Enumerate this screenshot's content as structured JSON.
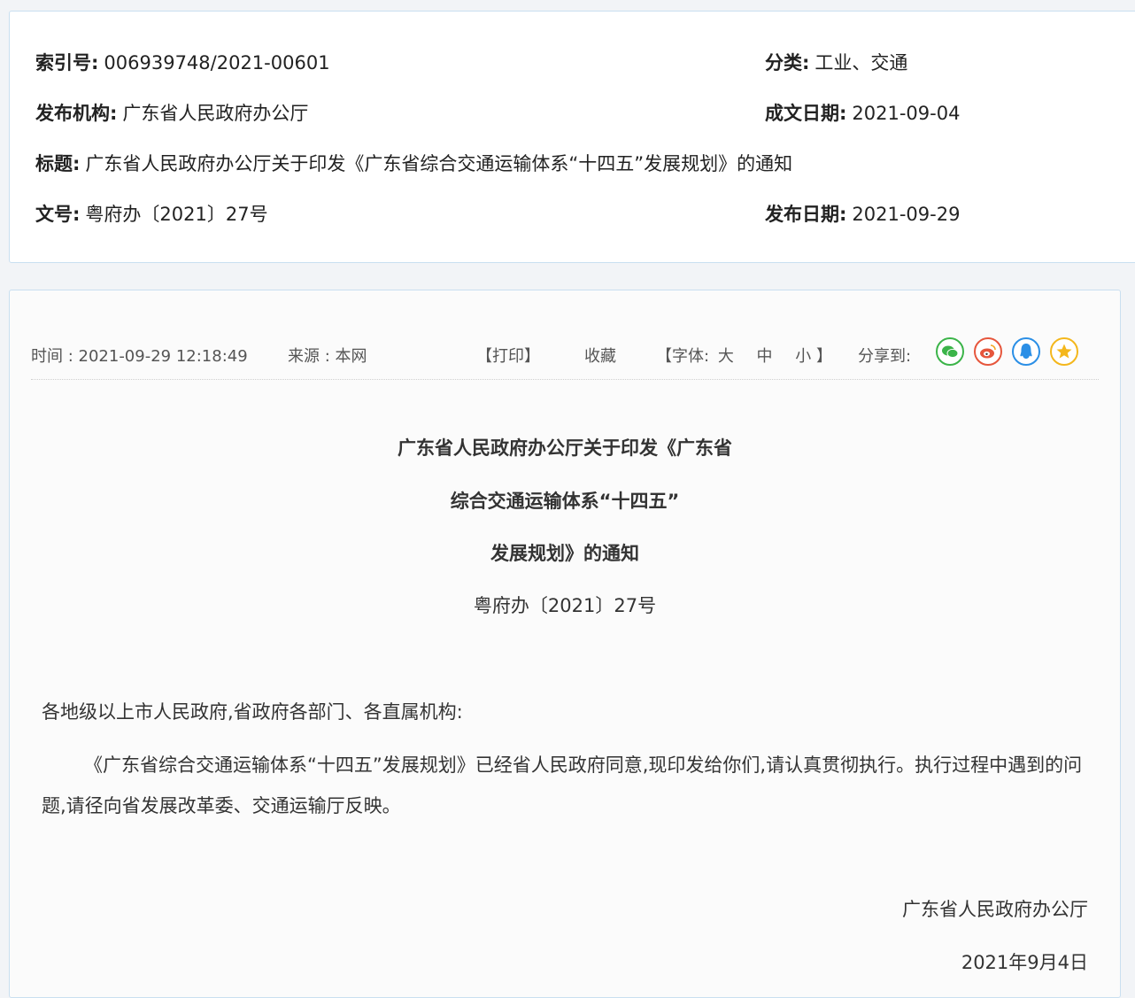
{
  "meta": {
    "index_label": "索引号:",
    "index_value": "006939748/2021-00601",
    "category_label": "分类:",
    "category_value": "工业、交通",
    "org_label": "发布机构:",
    "org_value": "广东省人民政府办公厅",
    "written_date_label": "成文日期:",
    "written_date_value": "2021-09-04",
    "title_label": "标题:",
    "title_value": "广东省人民政府办公厅关于印发《广东省综合交通运输体系“十四五”发展规划》的通知",
    "doc_no_label": "文号:",
    "doc_no_value": "粤府办〔2021〕27号",
    "publish_date_label": "发布日期:",
    "publish_date_value": "2021-09-29"
  },
  "info_bar": {
    "time": "时间 : 2021-09-29 12:18:49",
    "source": "来源 : 本网",
    "print": "【打印】",
    "favorite": "收藏",
    "font_open": "【字体:",
    "font_large": "大",
    "font_medium": "中",
    "font_small": "小",
    "font_close": "】",
    "share_label": "分享到:",
    "share_icons": [
      "wechat-icon",
      "weibo-icon",
      "qq-icon",
      "qzone-icon"
    ],
    "colors": {
      "wechat": "#3bb449",
      "weibo": "#e6563c",
      "qq": "#2b8fe6",
      "qzone": "#f4b71c"
    }
  },
  "article": {
    "title_line1": "广东省人民政府办公厅关于印发《广东省",
    "title_line2": "综合交通运输体系“十四五”",
    "title_line3": "发展规划》的通知",
    "doc_number": "粤府办〔2021〕27号",
    "salutation": "各地级以上市人民政府,省政府各部门、各直属机构:",
    "body": "《广东省综合交通运输体系“十四五”发展规划》已经省人民政府同意,现印发给你们,请认真贯彻执行。执行过程中遇到的问题,请径向省发展改革委、交通运输厅反映。",
    "signer": "广东省人民政府办公厅",
    "date": "2021年9月4日"
  }
}
